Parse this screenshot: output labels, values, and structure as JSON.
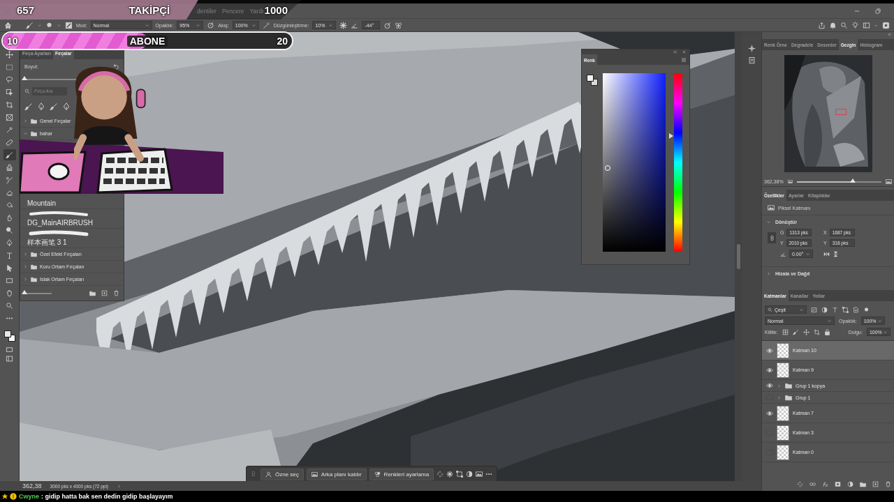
{
  "follower_goal": {
    "current": "657",
    "label": "TAKİPÇİ",
    "target": "1000",
    "level": 0.657
  },
  "menu_bar": {
    "items": [
      "dentiler",
      "Pencere",
      "Yardı"
    ]
  },
  "subscriber_goal": {
    "current": "10",
    "label": "ABONE",
    "target": "20",
    "level": 0.5
  },
  "options_bar": {
    "mode_label": "Mod:",
    "mode": "Normal",
    "opacity_label": "Opaklık:",
    "opacity": "95%",
    "flow_label": "Akış:",
    "flow": "100%",
    "smoothing_label": "Düzgünleştirme:",
    "smoothing": "10%",
    "angle": "-44°"
  },
  "tools": [
    {
      "kind": "move",
      "selected": false
    },
    {
      "kind": "marquee",
      "selected": false
    },
    {
      "kind": "lasso",
      "selected": false
    },
    {
      "kind": "objselect",
      "selected": false
    },
    {
      "kind": "crop",
      "selected": false
    },
    {
      "kind": "frame",
      "selected": false
    },
    {
      "kind": "eyedropper",
      "selected": false
    },
    {
      "kind": "healing",
      "selected": false
    },
    {
      "kind": "brush",
      "selected": true
    },
    {
      "kind": "stamp",
      "selected": false
    },
    {
      "kind": "history",
      "selected": false
    },
    {
      "kind": "eraser",
      "selected": false
    },
    {
      "kind": "bucket",
      "selected": false
    },
    {
      "kind": "smudge",
      "selected": false
    },
    {
      "kind": "dodge",
      "selected": false
    },
    {
      "kind": "pen",
      "selected": false
    },
    {
      "kind": "text",
      "selected": false
    },
    {
      "kind": "pathselect",
      "selected": false
    },
    {
      "kind": "rect",
      "selected": false
    },
    {
      "kind": "hand",
      "selected": false
    },
    {
      "kind": "zoom",
      "selected": false
    },
    {
      "kind": "more",
      "selected": false
    }
  ],
  "brush_panel": {
    "tabs": [
      {
        "label": "Fırça Ayarları",
        "selected": false
      },
      {
        "label": "Fırçalar",
        "selected": true
      }
    ],
    "size_label": "Boyut:",
    "size_slider": {
      "level": 0.0
    },
    "search_placeholder": "Fırça Ara",
    "groups": [
      {
        "name": "Genel Fırçalar",
        "expanded": false
      },
      {
        "name": "bahar",
        "expanded": true,
        "children": [
          {
            "name": "Mountain"
          },
          {
            "name": "DG_MainAIRBRUSH"
          },
          {
            "name": "样本画笔 3 1"
          }
        ]
      },
      {
        "name": "Özel Efekt Fırçaları",
        "expanded": false
      },
      {
        "name": "Kuru Ortam Fırçaları",
        "expanded": false
      },
      {
        "name": "Islak Ortam Fırçaları",
        "expanded": false
      }
    ],
    "preview_slider": {
      "level": 0.0
    }
  },
  "color_panel": {
    "tabs": [
      {
        "label": "Renk",
        "selected": true
      }
    ],
    "hue_slider": {
      "level": 0.65
    }
  },
  "navigator_panel": {
    "tabs": [
      {
        "label": "Renk Örne",
        "selected": false
      },
      {
        "label": "Degradele",
        "selected": false
      },
      {
        "label": "Desenler",
        "selected": false
      },
      {
        "label": "Gezgin",
        "selected": true
      },
      {
        "label": "Histogram",
        "selected": false
      }
    ],
    "zoom": "362,38%",
    "zoom_slider": {
      "level": 0.66
    }
  },
  "properties_panel": {
    "tabs": [
      {
        "label": "Özellikler",
        "selected": true
      },
      {
        "label": "Ayarlar",
        "selected": false
      },
      {
        "label": "Kitaplıklar",
        "selected": false
      }
    ],
    "layer_type": "Piksel Katmanı",
    "transform": {
      "title": "Dönüştür",
      "expanded": true,
      "w_label": "G",
      "w": "1313 pks",
      "x_label": "X",
      "x": "1687 pks",
      "h_label": "Y",
      "h": "2010 pks",
      "y_label": "Y",
      "y": "318 pks",
      "angle": "0.00°"
    },
    "align": {
      "title": "Hizala ve Dağıt",
      "expanded": false
    }
  },
  "layers_panel": {
    "tabs": [
      {
        "label": "Katmanlar",
        "selected": true
      },
      {
        "label": "Kanallar",
        "selected": false
      },
      {
        "label": "Yollar",
        "selected": false
      }
    ],
    "filter": "Çeşit",
    "blend_mode": "Normal",
    "opacity_label": "Opaklık:",
    "opacity": "100%",
    "lock_label": "Kilitle:",
    "fill_label": "Dolgu:",
    "fill": "100%",
    "layers": [
      {
        "name": "Katman 10",
        "kind": "layer",
        "visible": true,
        "selected": true
      },
      {
        "name": "Katman 9",
        "kind": "layer",
        "visible": true,
        "selected": false
      },
      {
        "name": "Grup 1 kopya",
        "kind": "group",
        "visible": true,
        "selected": false
      },
      {
        "name": "Grup 1",
        "kind": "group",
        "visible": false,
        "selected": false
      },
      {
        "name": "Katman 7",
        "kind": "layer",
        "visible": true,
        "selected": false
      },
      {
        "name": "Katman 3",
        "kind": "layer",
        "visible": false,
        "selected": false
      },
      {
        "name": "Katman 0",
        "kind": "layer",
        "visible": false,
        "selected": false
      }
    ]
  },
  "context_bar": {
    "buttons": [
      "Özne seç",
      "Arka planı kaldır",
      "Renkleri ayarlama"
    ]
  },
  "status_bar": {
    "zoom": "362,38",
    "doc_size": "3000 pks x 4000 pks (72 ppi)"
  },
  "chat": {
    "user": "Cwyne",
    "message": ": gidip hatta bak sen dedin gidip başlayayım"
  }
}
